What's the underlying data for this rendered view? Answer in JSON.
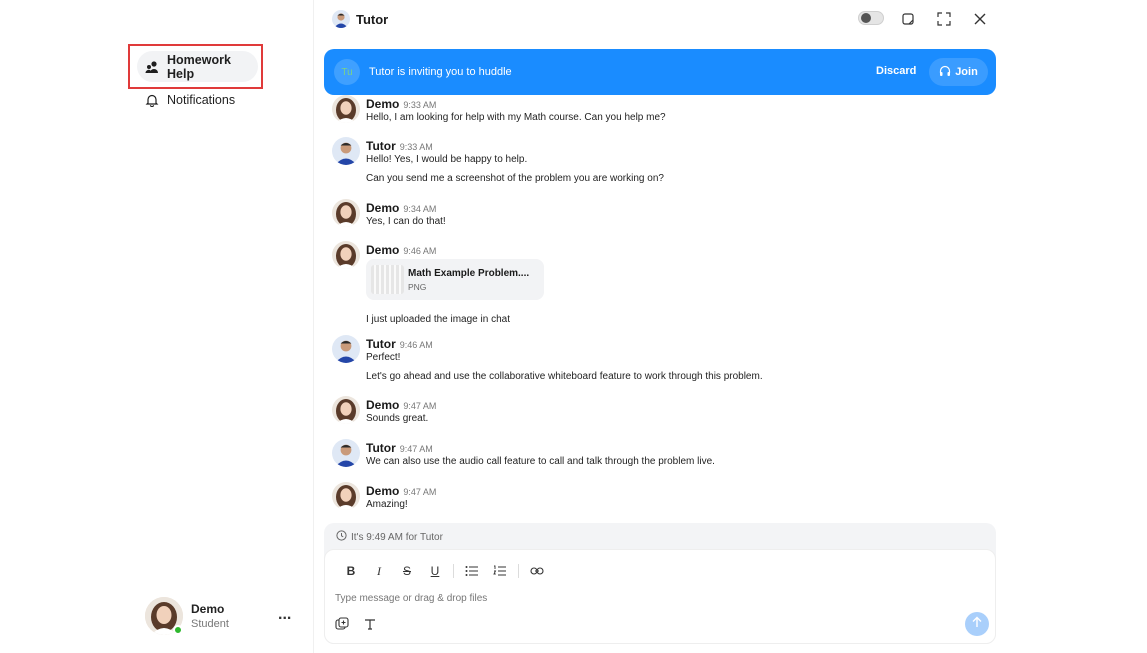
{
  "sidebar": {
    "nav": [
      {
        "label": "Homework Help",
        "icon": "users-icon",
        "active": true
      },
      {
        "label": "Notifications",
        "icon": "bell-icon",
        "active": false
      }
    ],
    "user": {
      "name": "Demo",
      "role": "Student",
      "status": "online",
      "more": "..."
    }
  },
  "header": {
    "title": "Tutor"
  },
  "huddle": {
    "avatar_initials": "Tu",
    "text": "Tutor is inviting you to huddle",
    "discard_label": "Discard",
    "join_label": "Join"
  },
  "messages": [
    {
      "sender": "Demo",
      "time": "9:33 AM",
      "lines": [
        "Hello, I am looking for help with my Math course. Can you help me?"
      ]
    },
    {
      "sender": "Tutor",
      "time": "9:33 AM",
      "lines": [
        "Hello! Yes, I would be happy to help.",
        "Can you send me a screenshot of the problem you are working on?"
      ]
    },
    {
      "sender": "Demo",
      "time": "9:34 AM",
      "lines": [
        "Yes, I can do that!"
      ]
    },
    {
      "sender": "Demo",
      "time": "9:46 AM",
      "attachment": {
        "name": "Math Example Problem....",
        "type": "PNG"
      },
      "lines": [
        "I just uploaded the image in chat"
      ]
    },
    {
      "sender": "Tutor",
      "time": "9:46 AM",
      "lines": [
        "Perfect!",
        "Let's go ahead and use the collaborative whiteboard feature to work through this problem."
      ]
    },
    {
      "sender": "Demo",
      "time": "9:47 AM",
      "lines": [
        "Sounds great."
      ]
    },
    {
      "sender": "Tutor",
      "time": "9:47 AM",
      "lines": [
        "We can also use the audio call feature to call and talk through the problem live."
      ]
    },
    {
      "sender": "Demo",
      "time": "9:47 AM",
      "lines": [
        "Amazing!"
      ]
    }
  ],
  "composer": {
    "local_time": "It's 9:49 AM for Tutor",
    "placeholder": "Type message or drag & drop files"
  },
  "colors": {
    "accent": "#1a8cff",
    "highlight_border": "#e03a3a",
    "online": "#2eb82e"
  }
}
